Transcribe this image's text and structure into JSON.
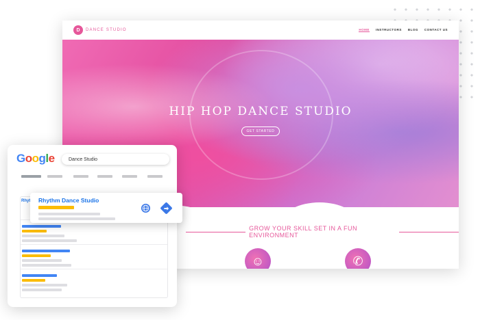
{
  "website": {
    "logo_mark": "D",
    "logo_text": "DANCE STUDIO",
    "nav": [
      "HOME",
      "INSTRUCTORS",
      "BLOG",
      "CONTACT US"
    ],
    "hero_title": "HIP HOP DANCE STUDIO",
    "hero_button": "GET STARTED",
    "tagline": "GROW YOUR SKILL SET IN A FUN ENVIRONMENT",
    "feature_icons": [
      "person-icon",
      "phone-icon"
    ]
  },
  "google": {
    "logo_letters": [
      {
        "char": "G",
        "color": "#4285f4"
      },
      {
        "char": "o",
        "color": "#ea4335"
      },
      {
        "char": "o",
        "color": "#fbbc05"
      },
      {
        "char": "g",
        "color": "#4285f4"
      },
      {
        "char": "l",
        "color": "#34a853"
      },
      {
        "char": "e",
        "color": "#ea4335"
      }
    ],
    "search_query": "Dance Studio",
    "first_result_peek": "Rhyth",
    "highlight_result": {
      "title": "Rhythm Dance Studio",
      "actions": [
        "globe-icon",
        "directions-icon"
      ]
    }
  },
  "colors": {
    "brand_pink": "#e6579a",
    "google_blue": "#4285f4",
    "google_yellow": "#fbbc05"
  }
}
